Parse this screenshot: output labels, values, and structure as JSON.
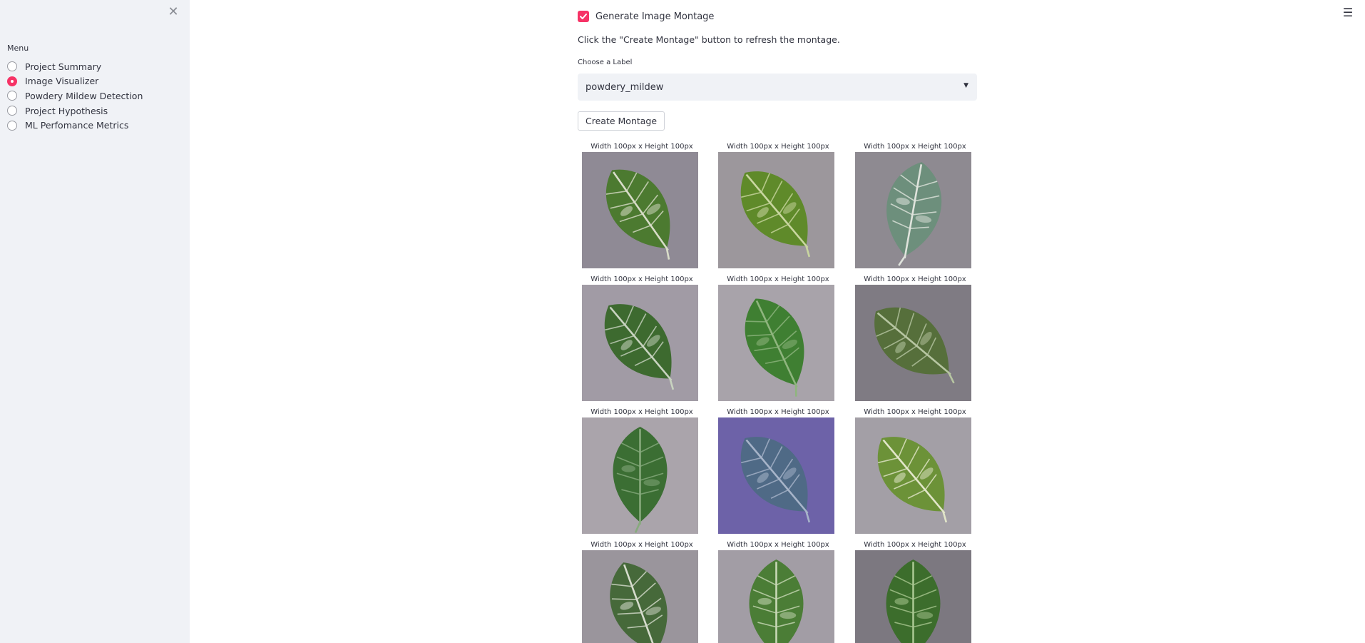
{
  "sidebar": {
    "menu_title": "Menu",
    "selected_index": 1,
    "items": [
      {
        "label": "Project Summary"
      },
      {
        "label": "Image Visualizer"
      },
      {
        "label": "Powdery Mildew Detection"
      },
      {
        "label": "Project Hypothesis"
      },
      {
        "label": "ML Perfomance Metrics"
      }
    ]
  },
  "main": {
    "checkbox_label": "Generate Image Montage",
    "checkbox_checked": true,
    "info_text": "Click the \"Create Montage\" button to refresh the montage.",
    "select_label": "Choose a Label",
    "select_value": "powdery_mildew",
    "button_label": "Create Montage"
  },
  "montage": {
    "caption": "Width 100px x Height 100px",
    "images": [
      {
        "bg": "#8f8a95",
        "leaf": "#4c7a30",
        "vein": "#d8dcc8"
      },
      {
        "bg": "#9c979c",
        "leaf": "#5f8a2a",
        "vein": "#c9d6a0"
      },
      {
        "bg": "#8e8a91",
        "leaf": "#6d8f7c",
        "vein": "#dfe3dc"
      },
      {
        "bg": "#a19ba5",
        "leaf": "#3d6a2f",
        "vein": "#c8d3c0"
      },
      {
        "bg": "#a8a3aa",
        "leaf": "#3f7f32",
        "vein": "#8fb57e"
      },
      {
        "bg": "#7f7b83",
        "leaf": "#566f3b",
        "vein": "#b7c6a2"
      },
      {
        "bg": "#aaa4ab",
        "leaf": "#3b6e33",
        "vein": "#87aa7d"
      },
      {
        "bg": "#6d62a8",
        "leaf": "#4f6a86",
        "vein": "#a7b4c9"
      },
      {
        "bg": "#a39fa6",
        "leaf": "#6c9238",
        "vein": "#e2e6c9"
      },
      {
        "bg": "#9a959c",
        "leaf": "#46693a",
        "vein": "#d6dccd"
      },
      {
        "bg": "#a29da5",
        "leaf": "#4b7d36",
        "vein": "#c8d8b6"
      },
      {
        "bg": "#7c7880",
        "leaf": "#3c6d2c",
        "vein": "#a7c690"
      }
    ]
  }
}
